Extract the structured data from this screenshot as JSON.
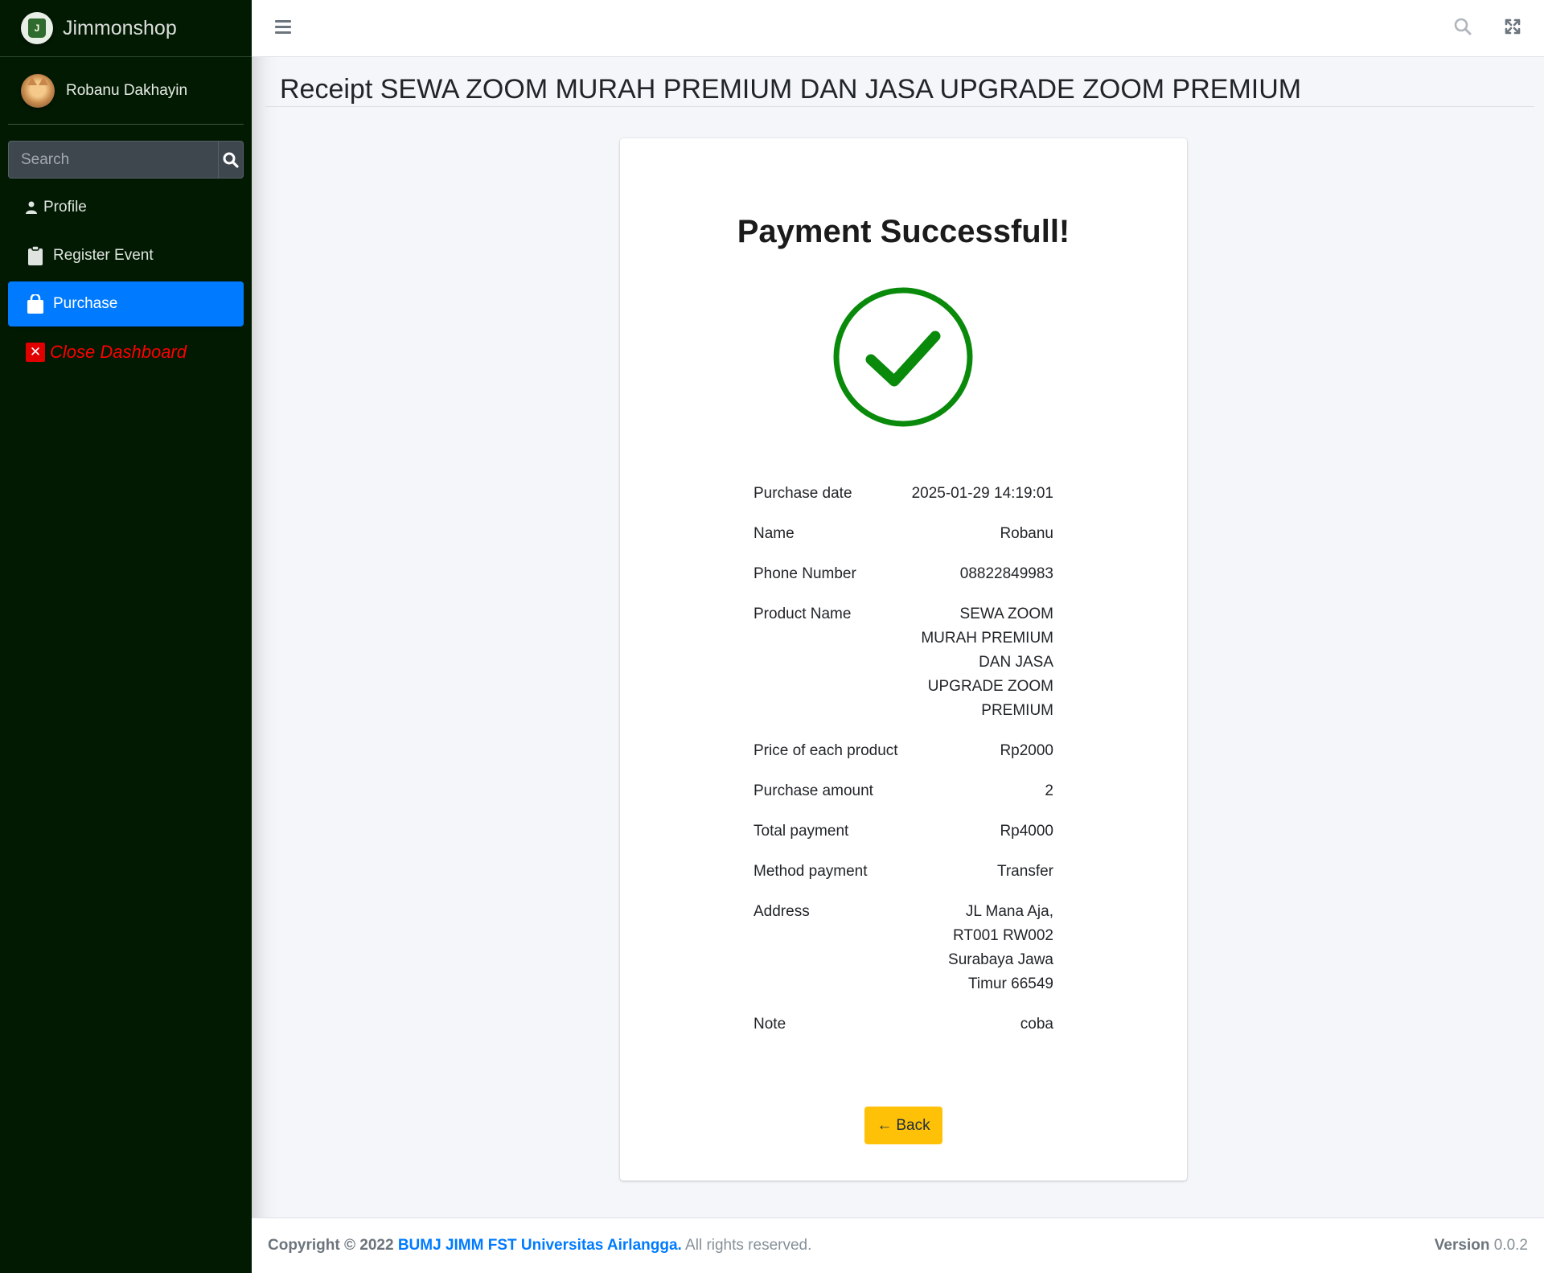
{
  "brand": {
    "name": "Jimmonshop",
    "logo_letter": "J"
  },
  "user": {
    "name": "Robanu Dakhayin"
  },
  "sidebar_search": {
    "placeholder": "Search"
  },
  "nav": {
    "profile": "Profile",
    "register_event": "Register Event",
    "purchase": "Purchase",
    "close_dashboard": "Close Dashboard"
  },
  "page_title": "Receipt SEWA ZOOM MURAH PREMIUM DAN JASA UPGRADE ZOOM PREMIUM",
  "receipt": {
    "heading": "Payment Successfull!",
    "rows": [
      {
        "label": "Purchase date",
        "value": "2025-01-29 14:19:01"
      },
      {
        "label": "Name",
        "value": "Robanu"
      },
      {
        "label": "Phone Number",
        "value": "08822849983"
      },
      {
        "label": "Product Name",
        "value": "SEWA ZOOM MURAH PREMIUM DAN JASA UPGRADE ZOOM PREMIUM"
      },
      {
        "label": "Price of each product",
        "value": "Rp2000"
      },
      {
        "label": "Purchase amount",
        "value": "2"
      },
      {
        "label": "Total payment",
        "value": "Rp4000"
      },
      {
        "label": "Method payment",
        "value": "Transfer"
      },
      {
        "label": "Address",
        "value": "JL Mana Aja, RT001 RW002 Surabaya Jawa Timur 66549"
      },
      {
        "label": "Note",
        "value": "coba"
      }
    ],
    "back_label": "Back"
  },
  "footer": {
    "copyright_prefix": "Copyright © 2022",
    "org": "BUMJ JIMM FST Universitas Airlangga.",
    "rights": "All rights reserved.",
    "version_label": "Version",
    "version": "0.0.2"
  },
  "colors": {
    "sidebar_bg": "#021a02",
    "active_nav": "#007bff",
    "success_green": "#0a8a0a",
    "back_button": "#ffc107",
    "close_red": "#ff0000"
  }
}
